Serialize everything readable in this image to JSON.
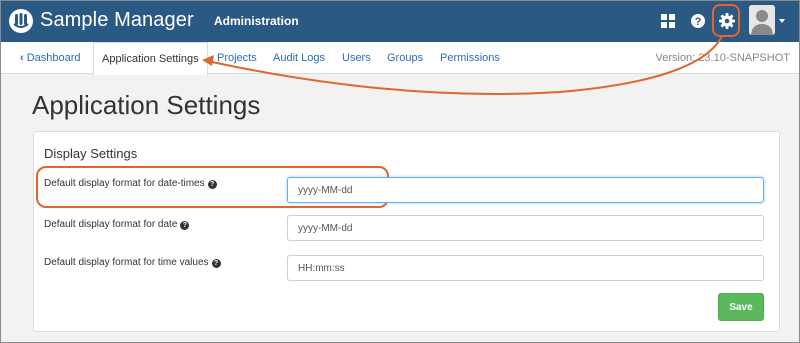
{
  "header": {
    "app_name": "Sample Manager",
    "section": "Administration"
  },
  "subnav": {
    "back_label": "Dashboard",
    "active_tab": "Application Settings",
    "tabs": [
      "Projects",
      "Audit Logs",
      "Users",
      "Groups",
      "Permissions"
    ],
    "version": "Version: 23.10-SNAPSHOT"
  },
  "page": {
    "title": "Application Settings",
    "panel_heading": "Display Settings"
  },
  "fields": [
    {
      "label": "Default display format for date-times",
      "value": "yyyy-MM-dd"
    },
    {
      "label": "Default display format for date",
      "value": "yyyy-MM-dd"
    },
    {
      "label": "Default display format for time values",
      "value": "HH:mm:ss"
    }
  ],
  "actions": {
    "save_label": "Save"
  },
  "colors": {
    "navbar": "#2a5a84",
    "link": "#2a6db5",
    "save": "#5cb85c",
    "annotation": "#e0652e"
  },
  "icons": [
    "app-logo-icon",
    "grid-icon",
    "help-icon",
    "gear-icon",
    "user-avatar-icon",
    "chevron-left-icon",
    "question-circle-icon"
  ]
}
